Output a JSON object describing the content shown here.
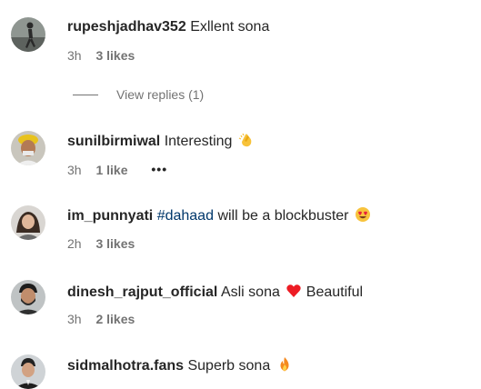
{
  "comments": [
    {
      "username": "rupeshjadhav352",
      "text": "Exllent sona",
      "time": "3h",
      "likes": "3 likes",
      "avatar_icon": "avatar-person-walking-icon"
    },
    {
      "username": "sunilbirmiwal",
      "text": "Interesting",
      "time": "3h",
      "likes": "1 like",
      "more": "•••",
      "emoji": "clapping-hands-icon",
      "avatar_icon": "avatar-man-turban-icon"
    },
    {
      "username": "im_punnyati",
      "hashtag": "#dahaad",
      "text": "will be a blockbuster",
      "time": "2h",
      "likes": "3 likes",
      "emoji": "heart-eyes-face-icon",
      "avatar_icon": "avatar-woman-icon"
    },
    {
      "username": "dinesh_rajput_official",
      "text": "Asli sona",
      "text2": "Beautiful",
      "time": "3h",
      "likes": "2 likes",
      "emoji": "red-heart-icon",
      "avatar_icon": "avatar-man-beard-icon"
    },
    {
      "username": "sidmalhotra.fans",
      "text": "Superb sona",
      "emoji": "fire-icon",
      "avatar_icon": "avatar-man-suit-icon"
    }
  ],
  "view_replies": "View replies (1)",
  "colors": {
    "text": "#262626",
    "secondary": "#737373",
    "hashtag": "#00376b",
    "heart": "#ed1c24",
    "fire": "#f58a1f"
  }
}
